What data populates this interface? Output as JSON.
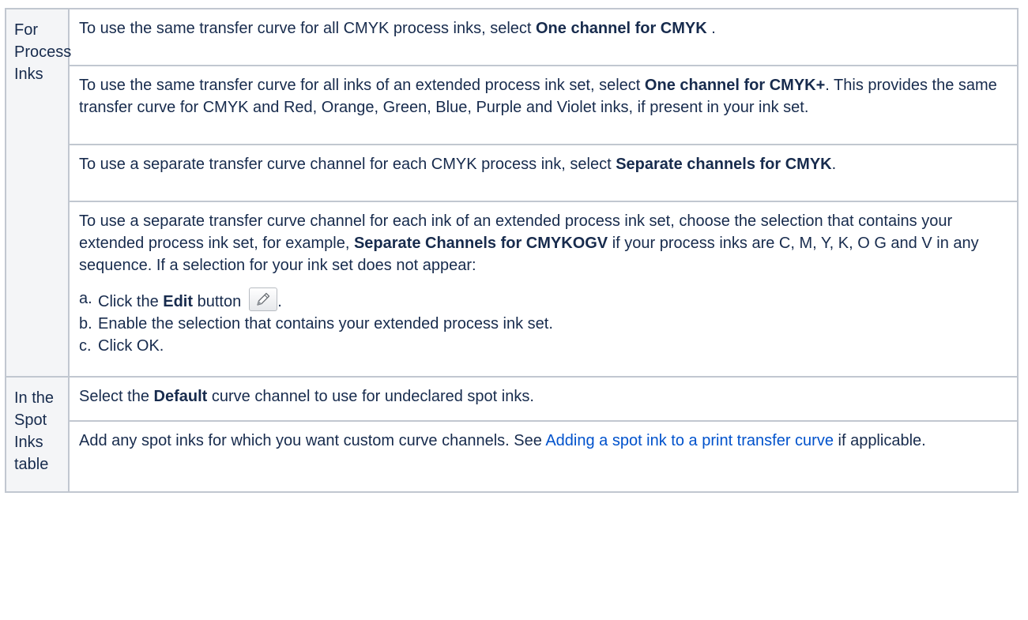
{
  "process": {
    "header": "For Process Inks",
    "row1": {
      "pre": "To use the same transfer curve for all CMYK process inks, select ",
      "bold": "One channel for CMYK",
      "post": " ."
    },
    "row2": {
      "pre": "To use the same transfer curve for all inks of an extended process ink set, select ",
      "bold": "One channel for CMYK+",
      "post": ". This provides the same transfer curve for CMYK and Red, Orange, Green, Blue, Purple and Violet inks, if present in your ink set."
    },
    "row3": {
      "pre": "To use a separate transfer curve channel for each CMYK process ink, select ",
      "bold": "Separate channels for CMYK",
      "post": "."
    },
    "row4": {
      "pre": "To use a separate transfer curve channel for each ink of an extended process ink set, choose the selection that contains your extended process ink set, for example, ",
      "bold": "Separate Channels for CMYKOGV",
      "post": " if your process inks are C, M, Y, K, O G and V in any sequence. If a selection for your ink set does not appear:",
      "steps": [
        {
          "marker": "a.",
          "pre": "Click the ",
          "bold": "Edit",
          "post": " button",
          "after_icon": ".",
          "icon": "pencil-edit-icon"
        },
        {
          "marker": "b.",
          "text": "Enable the selection that contains your extended process ink set."
        },
        {
          "marker": "c.",
          "text": "Click OK."
        }
      ]
    }
  },
  "spot": {
    "header": "In the Spot Inks table",
    "row1": {
      "pre": "Select the ",
      "bold": "Default",
      "post": " curve channel to use for undeclared spot inks."
    },
    "row2": {
      "pre": "Add any spot inks for which you want custom curve channels. See ",
      "link": "Adding a spot ink to a print transfer curve",
      "post": " if applicable."
    }
  },
  "colors": {
    "text": "#172b4d",
    "link": "#0052cc",
    "border": "#c1c7d0",
    "header_bg": "#f4f5f7"
  }
}
